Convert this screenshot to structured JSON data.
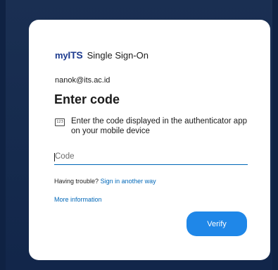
{
  "brand": {
    "logo_prefix": "my",
    "logo_suffix": "ITS",
    "title": "Single Sign-On"
  },
  "account": {
    "email": "nanok@its.ac.id"
  },
  "page": {
    "heading": "Enter code"
  },
  "hint": {
    "icon": "keypad-icon",
    "icon_glyph": "123",
    "text": "Enter the code displayed in the authenticator app on your mobile device"
  },
  "code_field": {
    "value": "",
    "placeholder": "Code"
  },
  "trouble": {
    "label": "Having trouble?",
    "link": "Sign in another way"
  },
  "more_info": {
    "link": "More information"
  },
  "actions": {
    "verify": "Verify"
  },
  "colors": {
    "accent": "#1f87e8",
    "link": "#0067b8",
    "background": "#152a4d",
    "brand": "#1d3b8f"
  }
}
